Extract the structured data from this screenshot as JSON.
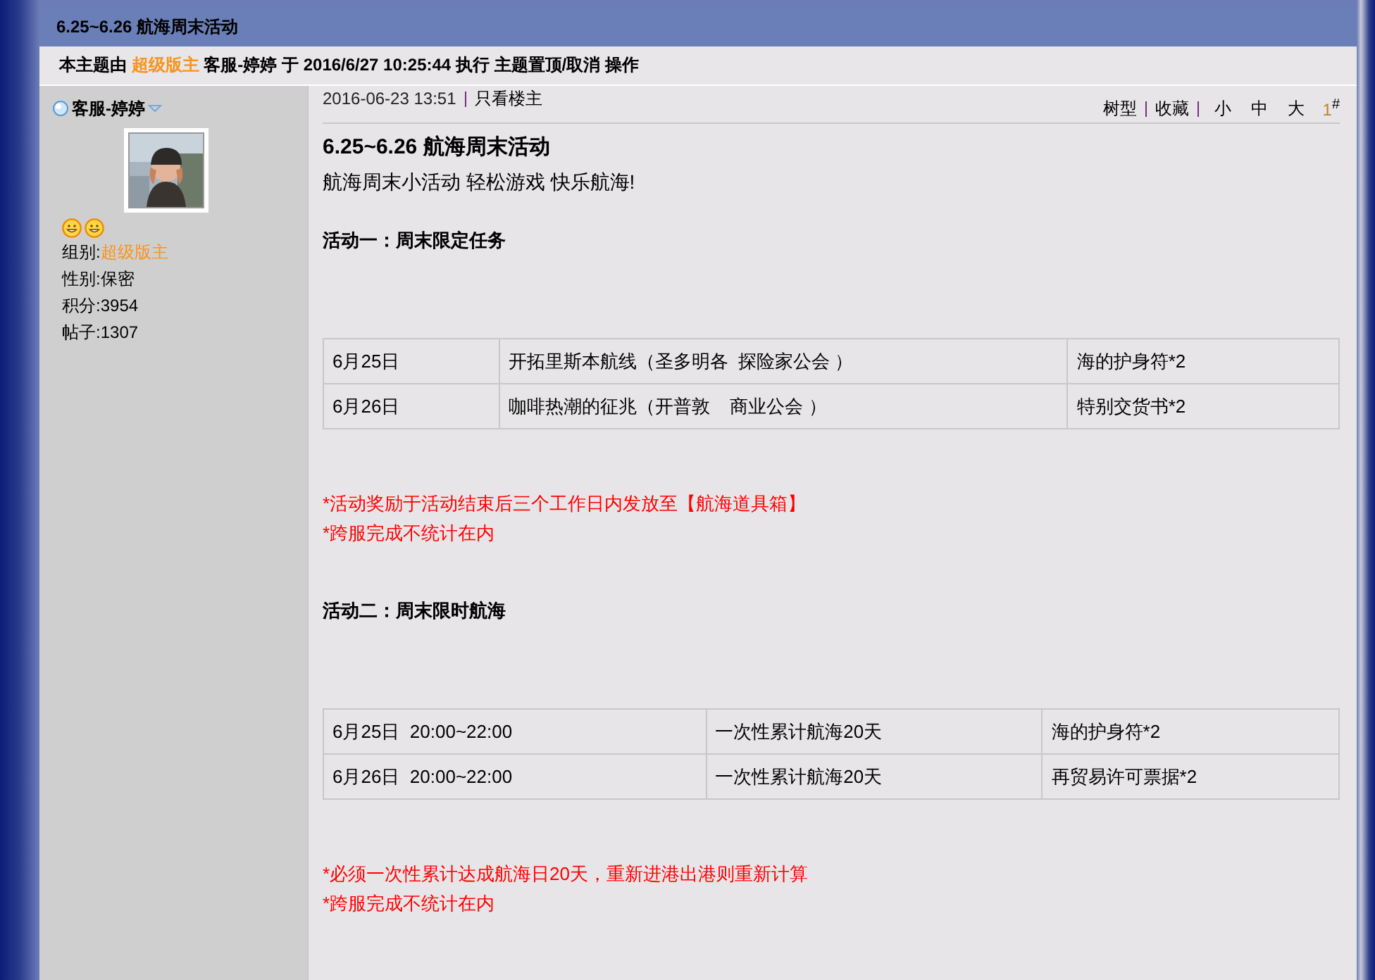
{
  "thread_title": "6.25~6.26 航海周末活动",
  "moderation": [
    {
      "text": "本主题由 ",
      "highlight": false
    },
    {
      "text": "超级版主",
      "highlight": true
    },
    {
      "text": " 客服-婷婷 于 2016/6/27 10:25:44 执行 主题置顶/取消 操作",
      "highlight": false
    }
  ],
  "author": {
    "name": "客服-婷婷",
    "online": true,
    "profile": [
      {
        "label": "组别:",
        "value": "超级版主",
        "highlight": true
      },
      {
        "label": "性别:",
        "value": "保密",
        "highlight": false
      },
      {
        "label": "积分:",
        "value": "3954",
        "highlight": false
      },
      {
        "label": "帖子:",
        "value": "1307",
        "highlight": false
      }
    ]
  },
  "post": {
    "date": "2016-06-23 13:51",
    "only_author": "只看楼主",
    "actions": [
      "树型",
      "收藏"
    ],
    "font_sizes": [
      "小",
      "中",
      "大"
    ],
    "floor": "1",
    "floor_mark": "#",
    "title": "6.25~6.26 航海周末活动",
    "intro": "航海周末小活动 轻松游戏 快乐航海!",
    "sections": [
      {
        "heading": "活动一：周末限定任务",
        "rows": [
          [
            "6月25日",
            "开拓里斯本航线（圣多明各  探险家公会 ）",
            "海的护身符*2"
          ],
          [
            "6月26日",
            "咖啡热潮的征兆（开普敦    商业公会 ）",
            "特别交货书*2"
          ]
        ],
        "notes": [
          "*活动奖励于活动结束后三个工作日内发放至【航海道具箱】",
          "*跨服完成不统计在内"
        ]
      },
      {
        "heading": "活动二：周末限时航海",
        "rows": [
          [
            "6月25日  20:00~22:00",
            "一次性累计航海20天",
            "海的护身符*2"
          ],
          [
            "6月26日  20:00~22:00",
            "一次性累计航海20天",
            "再贸易许可票据*2"
          ]
        ],
        "notes": [
          "*必须一次性累计达成航海日20天，重新进港出港则重新计算",
          "*跨服完成不统计在内"
        ]
      }
    ]
  }
}
